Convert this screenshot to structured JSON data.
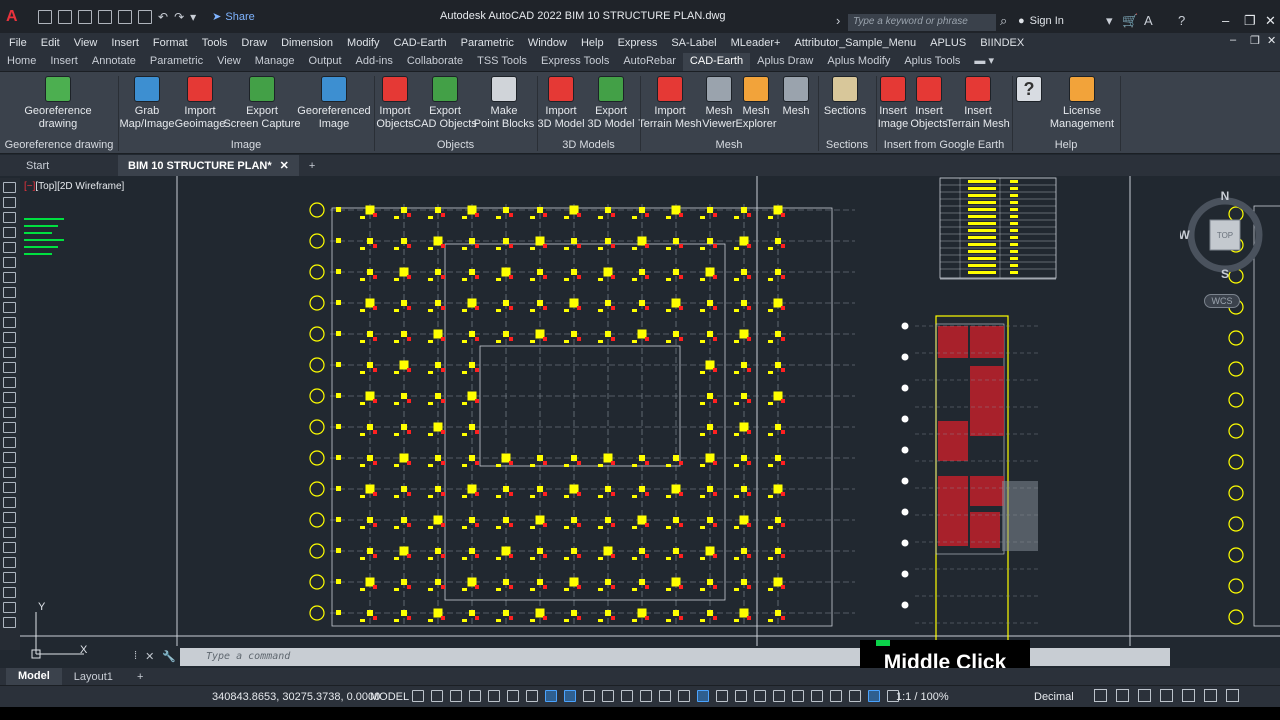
{
  "window": {
    "title": "Autodesk AutoCAD 2022    BIM 10 STRUCTURE PLAN.dwg",
    "share_label": "Share",
    "search_placeholder": "Type a keyword or phrase",
    "sign_in": "Sign In"
  },
  "menu": [
    "File",
    "Edit",
    "View",
    "Insert",
    "Format",
    "Tools",
    "Draw",
    "Dimension",
    "Modify",
    "CAD-Earth",
    "Parametric",
    "Window",
    "Help",
    "Express",
    "SA-Label",
    "MLeader+",
    "Attributor_Sample_Menu",
    "APLUS",
    "BIINDEX"
  ],
  "ribbon_tabs": [
    "Home",
    "Insert",
    "Annotate",
    "Parametric",
    "View",
    "Manage",
    "Output",
    "Add-ins",
    "Collaborate",
    "TSS Tools",
    "Express Tools",
    "AutoRebar",
    "CAD-Earth",
    "Aplus Draw",
    "Aplus Modify",
    "Aplus Tools"
  ],
  "active_ribbon_tab": "CAD-Earth",
  "ribbon": {
    "buttons": [
      {
        "line1": "Georeference drawing",
        "line2": "",
        "icon": "georeference-icon",
        "color": "#4caf50"
      },
      {
        "line1": "Grab",
        "line2": "Map/Image",
        "icon": "globe-icon",
        "color": "#3d8fd1"
      },
      {
        "line1": "Import",
        "line2": "Geoimage",
        "icon": "import-image-icon",
        "color": "#e53935"
      },
      {
        "line1": "Export",
        "line2": "Screen Capture",
        "icon": "export-capture-icon",
        "color": "#43a047"
      },
      {
        "line1": "Georeferenced",
        "line2": "Image",
        "icon": "globe-image-icon",
        "color": "#3d8fd1"
      },
      {
        "line1": "Import",
        "line2": "Objects",
        "icon": "import-objects-icon",
        "color": "#e53935"
      },
      {
        "line1": "Export",
        "line2": "CAD Objects",
        "icon": "export-objects-icon",
        "color": "#43a047"
      },
      {
        "line1": "Make",
        "line2": "Point Blocks",
        "icon": "point-blocks-icon",
        "color": "#d0d4d9"
      },
      {
        "line1": "Import",
        "line2": "3D Model",
        "icon": "import-3d-icon",
        "color": "#e53935"
      },
      {
        "line1": "Export",
        "line2": "3D Model",
        "icon": "export-3d-icon",
        "color": "#43a047"
      },
      {
        "line1": "Import",
        "line2": "Terrain Mesh",
        "icon": "import-terrain-icon",
        "color": "#e53935"
      },
      {
        "line1": "Mesh",
        "line2": "Viewer",
        "icon": "mesh-viewer-icon",
        "color": "#9aa3ad"
      },
      {
        "line1": "Mesh",
        "line2": "Explorer",
        "icon": "mesh-explorer-icon",
        "color": "#f2a33a"
      },
      {
        "line1": "Mesh",
        "line2": "",
        "icon": "mesh-icon",
        "color": "#9aa3ad"
      },
      {
        "line1": "Sections",
        "line2": "",
        "icon": "sections-icon",
        "color": "#d8c79a"
      },
      {
        "line1": "Insert",
        "line2": "Image",
        "icon": "insert-image-icon",
        "color": "#e53935"
      },
      {
        "line1": "Insert",
        "line2": "Objects",
        "icon": "insert-objects-icon",
        "color": "#e53935"
      },
      {
        "line1": "Insert",
        "line2": "Terrain Mesh",
        "icon": "insert-terrain-icon",
        "color": "#e53935"
      },
      {
        "line1": "",
        "line2": "",
        "icon": "help-icon",
        "color": "#d8dce2"
      },
      {
        "line1": "License",
        "line2": "Management",
        "icon": "key-icon",
        "color": "#f2a33a"
      }
    ],
    "panels": [
      "Georeference drawing",
      "Image",
      "Objects",
      "3D Models",
      "Mesh",
      "Sections",
      "Insert from Google Earth",
      "Help"
    ]
  },
  "file_tabs": {
    "start": "Start",
    "active": "BIM 10 STRUCTURE PLAN*"
  },
  "viewport_label": {
    "bracket": "[−]",
    "rest": "[Top][2D Wireframe]"
  },
  "command_placeholder": "Type a command",
  "overlay_caption": "Middle Click",
  "layout_tabs": [
    "Model",
    "Layout1"
  ],
  "status": {
    "coords": "340843.8653, 30275.3738, 0.0000",
    "model": "MODEL",
    "scale": "1:1 / 100%",
    "units": "Decimal"
  },
  "navcube": {
    "n": "N",
    "s": "S",
    "w": "W",
    "top": "TOP",
    "wcs": "WCS"
  },
  "ucs": {
    "y": "Y",
    "x": "X"
  },
  "colors": {
    "accent": "#e8323c",
    "yellow": "#ffff00",
    "red": "#ff2020",
    "background": "#212830"
  }
}
